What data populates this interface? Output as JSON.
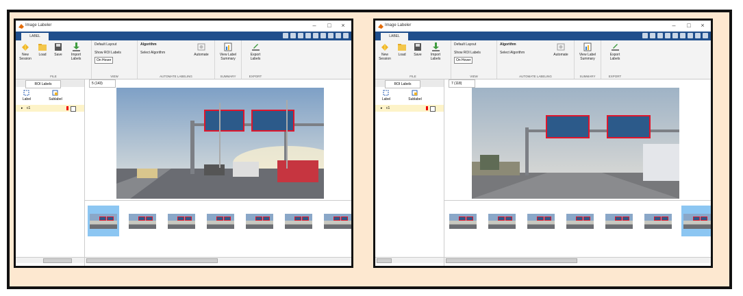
{
  "windows": [
    {
      "id": "left",
      "title": "Image Labeler",
      "ribbon_tab": "LABEL",
      "ribbon": {
        "file": {
          "new_session": "New Session",
          "load": "Load",
          "save": "Save",
          "import": "Import Labels",
          "group_label": "FILE"
        },
        "view": {
          "default_layout": "Default Layout",
          "show_roi_labels": "Show ROI Labels",
          "on_hover": "On Hover",
          "group_label": "VIEW"
        },
        "auto": {
          "algorithm": "Algorithm",
          "select_algorithm": "Select Algorithm",
          "automate": "Automate",
          "group_label": "AUTOMATE LABELING"
        },
        "summary": {
          "view_label_summary": "View Label Summary",
          "group_label": "SUMMARY"
        },
        "export": {
          "export_labels": "Export Labels",
          "group_label": "EXPORT"
        }
      },
      "left_panel": {
        "tab": "ROI Labels",
        "label_btn": "Label",
        "sublabel_btn": "Sublabel",
        "roi_name": "c1"
      },
      "main_tab": "5 (143)",
      "thumbnail_count": 7,
      "selected_thumbnail": 0
    },
    {
      "id": "right",
      "title": "Image Labeler",
      "ribbon_tab": "LABEL",
      "ribbon": {
        "file": {
          "new_session": "New Session",
          "load": "Load",
          "save": "Save",
          "import": "Import Labels",
          "group_label": "FILE"
        },
        "view": {
          "default_layout": "Default Layout",
          "show_roi_labels": "Show ROI Labels",
          "on_hover": "On Hover",
          "group_label": "VIEW"
        },
        "auto": {
          "algorithm": "Algorithm",
          "select_algorithm": "Select Algorithm",
          "automate": "Automate",
          "group_label": "AUTOMATE LABELING"
        },
        "summary": {
          "view_label_summary": "View Label Summary",
          "group_label": "SUMMARY"
        },
        "export": {
          "export_labels": "Export Labels",
          "group_label": "EXPORT"
        }
      },
      "left_panel": {
        "tab": "ROI Labels",
        "label_btn": "Label",
        "sublabel_btn": "Sublabel",
        "roi_name": "c1"
      },
      "main_tab": "7 (118)",
      "thumbnail_count": 7,
      "selected_thumbnail": 6
    }
  ],
  "colors": {
    "frame_bg": "#fde8d0",
    "ribbon_tab_bar": "#1f4e8c",
    "roi_box": "#e0152b",
    "selected_thumb": "#8cc6f2"
  }
}
